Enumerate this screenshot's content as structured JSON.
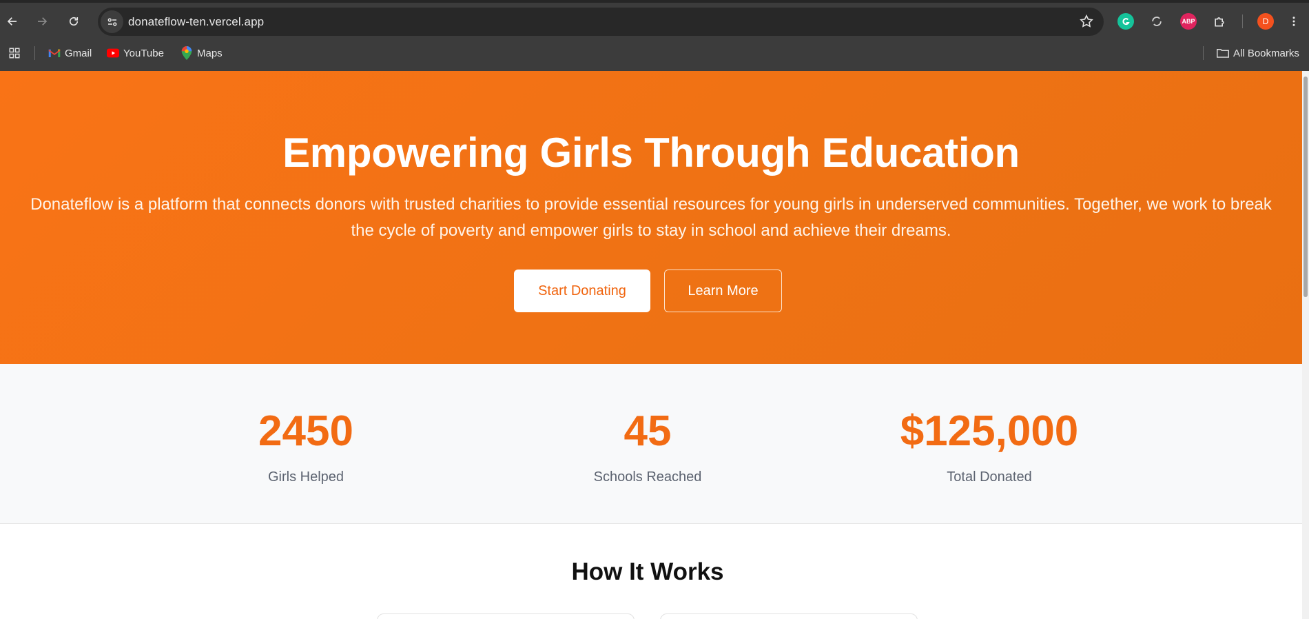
{
  "browser": {
    "url": "donateflow-ten.vercel.app",
    "bookmarks": [
      {
        "label": "Gmail",
        "icon": "gmail-icon"
      },
      {
        "label": "YouTube",
        "icon": "youtube-icon"
      },
      {
        "label": "Maps",
        "icon": "maps-icon"
      }
    ],
    "all_bookmarks_label": "All Bookmarks",
    "profile_initial": "D",
    "extensions": [
      "grammarly-icon",
      "sync-extension-icon",
      "adblock-plus-icon",
      "extensions-puzzle-icon"
    ],
    "abp_label": "ABP"
  },
  "hero": {
    "title": "Empowering Girls Through Education",
    "description": "Donateflow is a platform that connects donors with trusted charities to provide essential resources for young girls in underserved communities. Together, we work to break the cycle of poverty and empower girls to stay in school and achieve their dreams.",
    "primary_button": "Start Donating",
    "secondary_button": "Learn More",
    "background_color": "#f97316"
  },
  "stats": [
    {
      "value": "2450",
      "label": "Girls Helped"
    },
    {
      "value": "45",
      "label": "Schools Reached"
    },
    {
      "value": "$125,000",
      "label": "Total Donated"
    }
  ],
  "how_it_works": {
    "title": "How It Works"
  },
  "colors": {
    "accent": "#f26b13",
    "chrome_bg": "#3c3c3c",
    "stats_bg": "#f8f9fa"
  }
}
